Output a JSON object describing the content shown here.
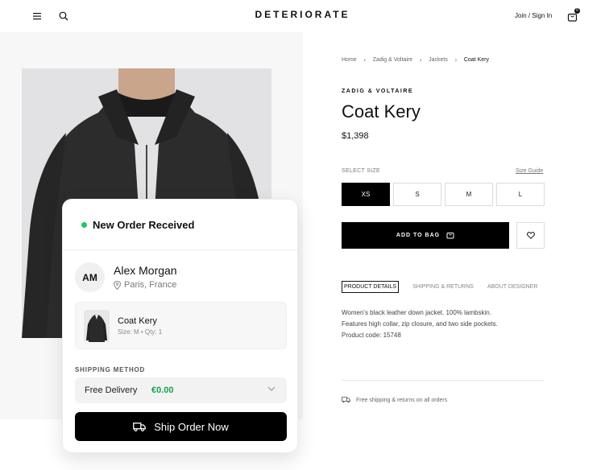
{
  "header": {
    "logo": "DETERIORATE",
    "signin_label": "Join / Sign In",
    "bag_count": "0"
  },
  "breadcrumb": [
    "Home",
    "Zadig & Voltaire",
    "Jackets",
    "Coat Kery"
  ],
  "product": {
    "brand": "ZADIG & VOLTAIRE",
    "title": "Coat Kery",
    "price": "$1,398",
    "select_size_label": "SELECT SIZE",
    "size_guide_label": "Size Guide",
    "sizes": [
      "XS",
      "S",
      "M",
      "L"
    ],
    "selected_size": "XS",
    "add_to_bag_label": "ADD TO BAG",
    "tabs": [
      "PRODUCT DETAILS",
      "SHIPPING & RETURNS",
      "ABOUT DESIGNER"
    ],
    "active_tab": "PRODUCT DETAILS",
    "description": [
      "Women's black leather down jacket. 100% lambskin.",
      "Features high collar, zip closure, and two side pockets.",
      "Product code: 15748"
    ],
    "shipping_note": "Free shipping & returns on all orders"
  },
  "order_card": {
    "title": "New Order Received",
    "status_color": "#22c55e",
    "customer_initials": "AM",
    "customer_name": "Alex Morgan",
    "customer_location": "Paris, France",
    "item_name": "Coat Kery",
    "item_meta": "Size: M • Qty: 1",
    "shipping_method_label": "SHIPPING METHOD",
    "shipping_option": "Free Delivery",
    "shipping_price": "€0.00",
    "cta_label": "Ship Order Now"
  },
  "icons": {
    "menu": "menu-icon",
    "search": "search-icon",
    "bag": "bag-icon",
    "heart": "heart-icon",
    "truck": "truck-icon",
    "pin": "location-pin-icon",
    "chevron": "chevron-down-icon"
  }
}
